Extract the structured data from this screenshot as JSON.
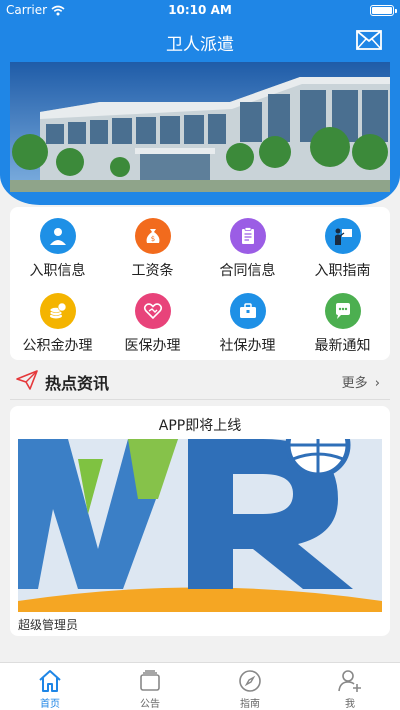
{
  "status_bar": {
    "carrier": "Carrier",
    "time": "10:10 AM"
  },
  "nav": {
    "title": "卫人派遣"
  },
  "menu": [
    {
      "label": "入职信息",
      "icon": "person-icon",
      "color": "#1e90e6"
    },
    {
      "label": "工资条",
      "icon": "money-bag-icon",
      "color": "#f26b1d"
    },
    {
      "label": "合同信息",
      "icon": "document-icon",
      "color": "#9b5de5"
    },
    {
      "label": "入职指南",
      "icon": "presentation-icon",
      "color": "#1e90e6"
    },
    {
      "label": "公积金办理",
      "icon": "coins-icon",
      "color": "#f4b400"
    },
    {
      "label": "医保办理",
      "icon": "heart-handshake-icon",
      "color": "#e8437a"
    },
    {
      "label": "社保办理",
      "icon": "briefcase-icon",
      "color": "#1e90e6"
    },
    {
      "label": "最新通知",
      "icon": "chat-icon",
      "color": "#4caf50"
    }
  ],
  "hot": {
    "title": "热点资讯",
    "more": "更多"
  },
  "news": {
    "title": "APP即将上线",
    "author": "超级管理员"
  },
  "tabs": [
    {
      "label": "首页",
      "active": true
    },
    {
      "label": "公告",
      "active": false
    },
    {
      "label": "指南",
      "active": false
    },
    {
      "label": "我",
      "active": false
    }
  ]
}
